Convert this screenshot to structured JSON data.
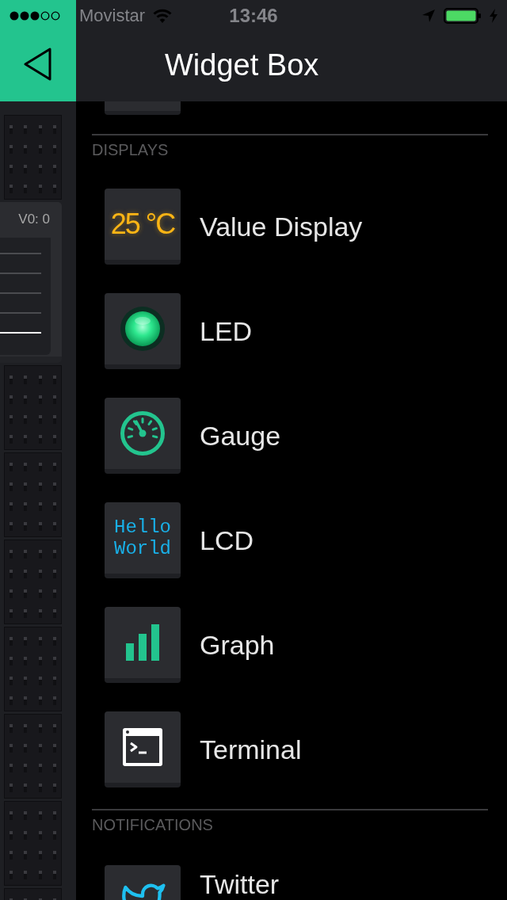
{
  "status_bar": {
    "carrier": "Movistar",
    "time": "13:46",
    "location_active": true,
    "charging": true
  },
  "header": {
    "title": "Widget Box"
  },
  "canvas": {
    "widget": {
      "pin_label": "V0: 0"
    }
  },
  "sections": [
    {
      "heading": "DISPLAYS",
      "items": [
        {
          "kind": "value_display",
          "label": "Value Display",
          "icon_text": "25 °C"
        },
        {
          "kind": "led",
          "label": "LED"
        },
        {
          "kind": "gauge",
          "label": "Gauge"
        },
        {
          "kind": "lcd",
          "label": "LCD",
          "icon_lines": [
            "Hello",
            "World"
          ]
        },
        {
          "kind": "graph",
          "label": "Graph"
        },
        {
          "kind": "terminal",
          "label": "Terminal"
        }
      ]
    },
    {
      "heading": "NOTIFICATIONS",
      "items": [
        {
          "kind": "twitter",
          "label": "Twitter"
        }
      ]
    }
  ]
}
